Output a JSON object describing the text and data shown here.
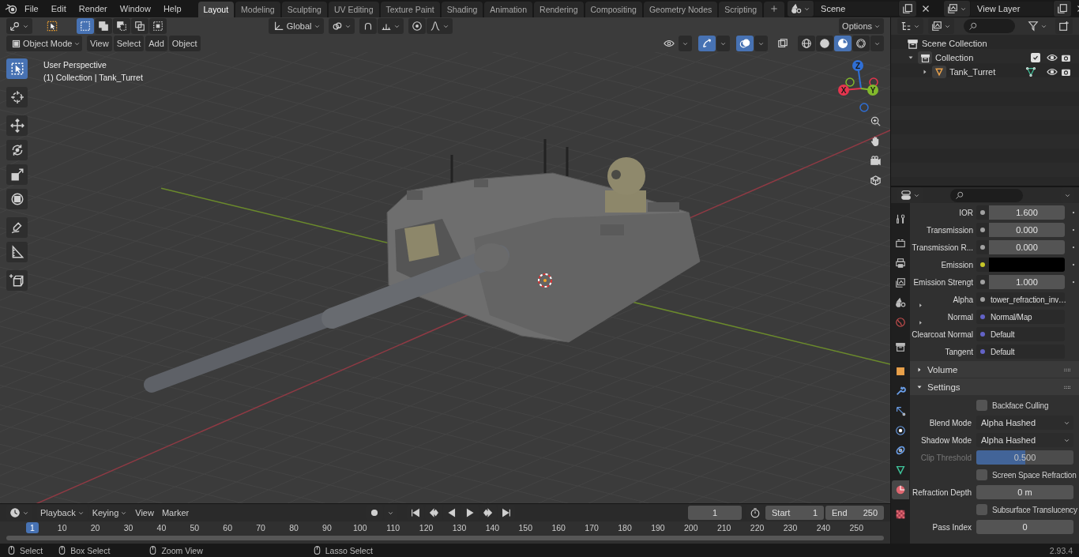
{
  "topbar": {
    "menus": [
      "File",
      "Edit",
      "Render",
      "Window",
      "Help"
    ],
    "workspaces": [
      {
        "label": "Layout",
        "selected": true
      },
      {
        "label": "Modeling",
        "selected": false
      },
      {
        "label": "Sculpting",
        "selected": false
      },
      {
        "label": "UV Editing",
        "selected": false
      },
      {
        "label": "Texture Paint",
        "selected": false
      },
      {
        "label": "Shading",
        "selected": false
      },
      {
        "label": "Animation",
        "selected": false
      },
      {
        "label": "Rendering",
        "selected": false
      },
      {
        "label": "Compositing",
        "selected": false
      },
      {
        "label": "Geometry Nodes",
        "selected": false
      },
      {
        "label": "Scripting",
        "selected": false
      }
    ],
    "scene": "Scene",
    "view_layer": "View Layer"
  },
  "tool_header": {
    "select_modes": [
      {
        "kind": "new",
        "selected": true
      },
      {
        "kind": "extend",
        "selected": false
      },
      {
        "kind": "subtract",
        "selected": false
      },
      {
        "kind": "difference",
        "selected": false
      },
      {
        "kind": "intersect",
        "selected": false
      }
    ],
    "orientation": "Global",
    "options": "Options"
  },
  "view_header": {
    "mode": "Object Mode",
    "menus": [
      "View",
      "Select",
      "Add",
      "Object"
    ],
    "toggles": [
      {
        "kind": "visibility",
        "on": false
      },
      {
        "kind": "gizmo",
        "on": true
      },
      {
        "kind": "overlay",
        "on": true
      },
      {
        "kind": "xray",
        "on": false
      }
    ],
    "shading": [
      {
        "kind": "wireframe",
        "selected": false
      },
      {
        "kind": "solid",
        "selected": false
      },
      {
        "kind": "material",
        "selected": true
      },
      {
        "kind": "rendered",
        "selected": false
      }
    ]
  },
  "viewport": {
    "info": [
      "User Perspective",
      "(1) Collection | Tank_Turret"
    ],
    "tools": [
      {
        "kind": "select",
        "selected": true
      },
      {
        "kind": "cursor",
        "selected": false
      },
      {
        "kind": "move",
        "selected": false
      },
      {
        "kind": "rotate",
        "selected": false
      },
      {
        "kind": "scale",
        "selected": false
      },
      {
        "kind": "transform",
        "selected": false
      },
      {
        "kind": "annotate",
        "selected": false
      },
      {
        "kind": "measure",
        "selected": false
      },
      {
        "kind": "add_cube",
        "selected": false
      }
    ],
    "gizmo": [
      {
        "label": "Z",
        "color": "#2f6fd6"
      },
      {
        "label": "Y",
        "color": "#82b92c"
      },
      {
        "label": "X",
        "color": "#e5354e"
      }
    ]
  },
  "outliner": {
    "items": [
      {
        "label": "Scene Collection",
        "kind": "scene",
        "children": [
          {
            "label": "Collection",
            "kind": "collection",
            "expanded": true,
            "checked": true,
            "children": [
              {
                "label": "Tank_Turret",
                "kind": "object",
                "expanded": false
              }
            ]
          }
        ]
      }
    ]
  },
  "properties": {
    "tabs": [
      {
        "kind": "tool",
        "selected": false
      },
      {
        "kind": "render",
        "selected": false
      },
      {
        "kind": "output",
        "selected": false
      },
      {
        "kind": "view_layer",
        "selected": false
      },
      {
        "kind": "scene",
        "selected": false
      },
      {
        "kind": "world",
        "selected": false
      },
      {
        "kind": "collection",
        "selected": false
      },
      {
        "kind": "object",
        "selected": false
      },
      {
        "kind": "modifiers",
        "selected": false
      },
      {
        "kind": "particles",
        "selected": false
      },
      {
        "kind": "physics",
        "selected": false
      },
      {
        "kind": "constraints",
        "selected": false
      },
      {
        "kind": "data",
        "selected": false
      },
      {
        "kind": "material",
        "selected": true
      },
      {
        "kind": "texture",
        "selected": false
      }
    ],
    "rows": [
      {
        "label": "IOR",
        "kind": "number",
        "color": "#a1a1a1",
        "value": "1.600"
      },
      {
        "label": "Transmission",
        "kind": "number",
        "color": "#a1a1a1",
        "value": "0.000"
      },
      {
        "label": "Transmission R...",
        "kind": "number",
        "color": "#a1a1a1",
        "value": "0.000"
      },
      {
        "label": "Emission",
        "kind": "color",
        "color": "#c7c729"
      },
      {
        "label": "Emission Strengt",
        "kind": "number",
        "color": "#a1a1a1",
        "value": "1.000"
      },
      {
        "label": "Alpha",
        "kind": "link",
        "color": "#a1a1a1",
        "value": "tower_refraction_inv…",
        "expanded": false
      },
      {
        "label": "Normal",
        "kind": "link",
        "color": "#6363c7",
        "value": "Normal/Map",
        "expanded": false
      },
      {
        "label": "Clearcoat Normal",
        "kind": "default",
        "color": "#6363c7",
        "value": "Default"
      },
      {
        "label": "Tangent",
        "kind": "default",
        "color": "#6363c7",
        "value": "Default"
      }
    ],
    "panels": [
      {
        "label": "Volume",
        "expanded": false
      },
      {
        "label": "Settings",
        "expanded": true,
        "rows": [
          {
            "kind": "checkbox",
            "label": "Backface Culling",
            "checked": false
          },
          {
            "kind": "dropdown",
            "label": "Blend Mode",
            "value": "Alpha Hashed"
          },
          {
            "kind": "dropdown",
            "label": "Shadow Mode",
            "value": "Alpha Hashed"
          },
          {
            "kind": "slider",
            "label": "Clip Threshold",
            "value": "0.500",
            "level": 0.5,
            "disabled": true
          },
          {
            "kind": "checkbox",
            "label": "Screen Space Refraction",
            "checked": false
          },
          {
            "kind": "number",
            "label": "Refraction Depth",
            "value": "0 m"
          },
          {
            "kind": "checkbox",
            "label": "Subsurface Translucency",
            "checked": false
          },
          {
            "kind": "number",
            "label": "Pass Index",
            "value": "0"
          }
        ]
      }
    ]
  },
  "timeline": {
    "menus": [
      {
        "label": "Playback",
        "kind": "dropdown"
      },
      {
        "label": "Keying",
        "kind": "dropdown"
      },
      {
        "label": "View",
        "kind": "menu"
      },
      {
        "label": "Marker",
        "kind": "menu"
      }
    ],
    "current_frame": "1",
    "start": {
      "label": "Start",
      "value": "1"
    },
    "end": {
      "label": "End",
      "value": "250"
    },
    "playhead": "1",
    "ruler": [
      "10",
      "20",
      "30",
      "40",
      "50",
      "60",
      "70",
      "80",
      "90",
      "100",
      "110",
      "120",
      "130",
      "140",
      "150",
      "160",
      "170",
      "180",
      "190",
      "200",
      "210",
      "220",
      "230",
      "240",
      "250"
    ]
  },
  "status_bar": {
    "items": [
      "Select",
      "Box Select",
      "Zoom View",
      "Lasso Select"
    ],
    "version": "2.93.4"
  }
}
